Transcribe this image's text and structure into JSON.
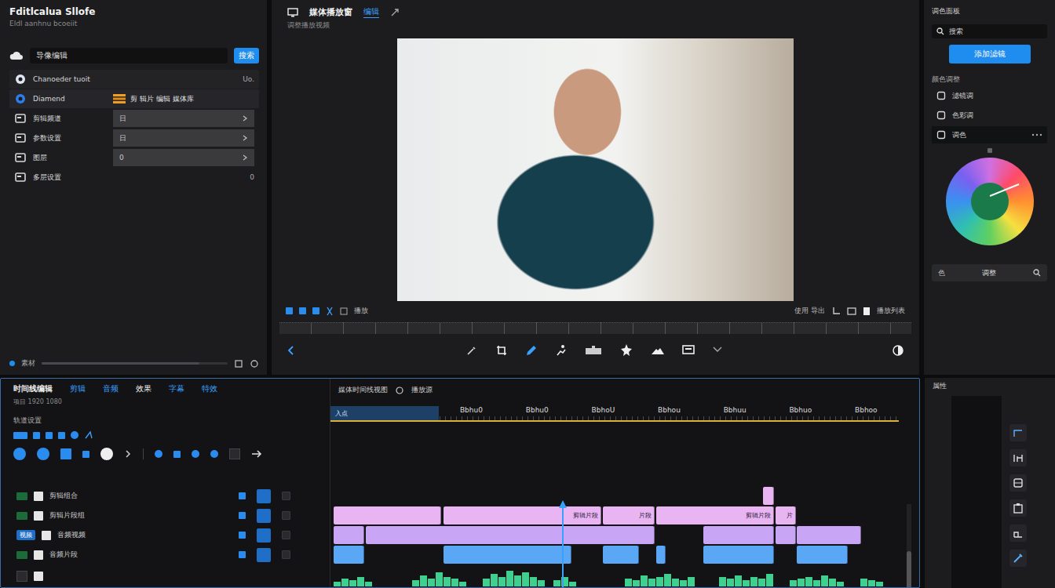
{
  "app": {
    "title": "Fditlcalua Sllofe",
    "subtitle": "Eldl aanhnu bcoeiit"
  },
  "left_panel": {
    "search": {
      "value": "导像编辑",
      "button": "搜索"
    },
    "items": [
      {
        "kind": "row",
        "label": "Chanoeder tuoit",
        "value": "Uo.",
        "selected": false
      },
      {
        "kind": "tag",
        "label": "Diamend",
        "value": "剪 辑片 编辑 媒体库",
        "selected": true
      },
      {
        "kind": "field",
        "label": "剪辑频道",
        "value": "日",
        "selected": false
      },
      {
        "kind": "field",
        "label": "参数设置",
        "value": "日",
        "selected": false
      },
      {
        "kind": "field",
        "label": "图层",
        "value": "0",
        "selected": false
      },
      {
        "kind": "row",
        "label": "多层设置",
        "value": "0",
        "selected": false
      }
    ],
    "footer": {
      "label": "素材",
      "level": 0.85
    }
  },
  "viewer": {
    "title": "媒体播放窗",
    "tabs": [
      {
        "label": "编辑",
        "selected": true
      }
    ],
    "subtitle": "调整播放视频",
    "status": "播放",
    "actions": "使用 导出",
    "playlist": "播放列表"
  },
  "right_panel": {
    "title": "调色面板",
    "search": "搜索",
    "button": "添加滤镜",
    "section": "颜色调整",
    "items": [
      {
        "label": "滤镜调",
        "selected": false
      },
      {
        "label": "色彩调",
        "selected": false
      },
      {
        "label": "调色",
        "selected": true
      }
    ],
    "bottom": {
      "label": "色",
      "value": "调整"
    }
  },
  "timeline": {
    "title": "时间线编辑",
    "tabs": [
      {
        "label": "剪辑",
        "selected": false
      },
      {
        "label": "音频",
        "selected": false
      },
      {
        "label": "效果",
        "selected": true
      },
      {
        "label": "字幕",
        "selected": false
      },
      {
        "label": "特效",
        "selected": false
      }
    ],
    "subtitle": "项目 1920 1080",
    "tracks_label": "轨道设置",
    "view_label": "媒体时间线视图",
    "source_label": "播放源",
    "range": {
      "label": "入点",
      "end": 0.19
    },
    "ticks": [
      "Bbhu0",
      "Bbhu0",
      "BbhoU",
      "Bbhou",
      "Bbhuu",
      "Bbhuo",
      "Bbhoo"
    ],
    "playhead": 0.404,
    "tracks": [
      {
        "label": "剪辑组合",
        "badge": "",
        "clips": [
          {
            "label": "",
            "start": 0.76,
            "end": 0.779,
            "color": "#e8b4f2"
          }
        ]
      },
      {
        "label": "剪辑片段组",
        "badge": "",
        "clips": [
          {
            "label": "",
            "start": 0.0,
            "end": 0.19,
            "color": "#e8b4f2"
          },
          {
            "label": "剪辑片段",
            "start": 0.195,
            "end": 0.473,
            "color": "#e8b4f2"
          },
          {
            "label": "片段",
            "start": 0.477,
            "end": 0.568,
            "color": "#e8b4f2"
          },
          {
            "label": "剪辑片段",
            "start": 0.571,
            "end": 0.779,
            "color": "#e8b4f2"
          },
          {
            "label": "片",
            "start": 0.782,
            "end": 0.818,
            "color": "#e8b4f2"
          }
        ]
      },
      {
        "label": "音频视频",
        "badge": "视频",
        "clips": [
          {
            "label": "",
            "start": 0.0,
            "end": 0.054,
            "color": "#c9a6f5"
          },
          {
            "label": "",
            "start": 0.057,
            "end": 0.568,
            "color": "#c9a6f5"
          },
          {
            "label": "",
            "start": 0.654,
            "end": 0.779,
            "color": "#c9a6f5"
          },
          {
            "label": "",
            "start": 0.782,
            "end": 0.818,
            "color": "#c9a6f5"
          },
          {
            "label": "",
            "start": 0.82,
            "end": 0.934,
            "color": "#c9a6f5"
          }
        ]
      },
      {
        "label": "音频片段",
        "badge": "",
        "clips": [
          {
            "label": "",
            "start": 0.0,
            "end": 0.054,
            "color": "#5aa8f5"
          },
          {
            "label": "",
            "start": 0.195,
            "end": 0.421,
            "color": "#5aa8f5"
          },
          {
            "label": "",
            "start": 0.477,
            "end": 0.54,
            "color": "#5aa8f5"
          },
          {
            "label": "",
            "start": 0.571,
            "end": 0.588,
            "color": "#5aa8f5"
          },
          {
            "label": "",
            "start": 0.654,
            "end": 0.779,
            "color": "#5aa8f5"
          },
          {
            "label": "",
            "start": 0.82,
            "end": 0.91,
            "color": "#5aa8f5"
          }
        ]
      }
    ],
    "waveform": [
      0.3,
      0.5,
      0.4,
      0.6,
      0.3,
      0,
      0,
      0,
      0,
      0,
      0.4,
      0.7,
      0.5,
      0.9,
      0.6,
      0.5,
      0.3,
      0,
      0,
      0.5,
      0.8,
      0.6,
      1,
      0.7,
      0.9,
      0.6,
      0.4,
      0,
      0.4,
      0.6,
      0.3,
      0,
      0,
      0,
      0,
      0,
      0,
      0.5,
      0.4,
      0.7,
      0.5,
      0.6,
      0.8,
      0.5,
      0.4,
      0.6,
      0,
      0,
      0,
      0.6,
      0.5,
      0.7,
      0.4,
      0.6,
      0.5,
      0.8,
      0,
      0,
      0.4,
      0.5,
      0.6,
      0.4,
      0.7,
      0.5,
      0.3,
      0,
      0,
      0.5,
      0.4,
      0.3,
      0,
      0
    ]
  },
  "properties": {
    "title": "属性"
  }
}
